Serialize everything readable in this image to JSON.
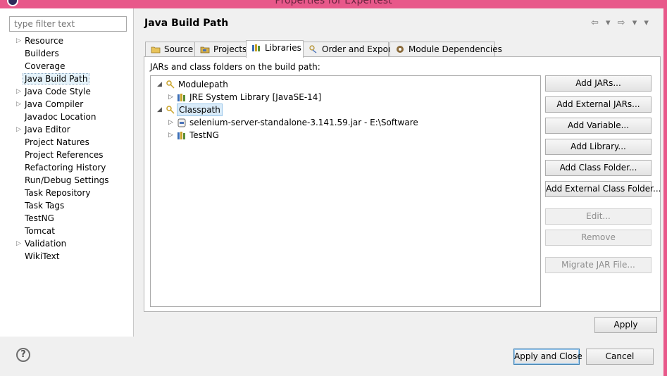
{
  "window": {
    "title": "Properties for Expertest"
  },
  "filter": {
    "placeholder": "type filter text"
  },
  "sidebar": {
    "items": [
      {
        "label": "Resource",
        "expandable": true
      },
      {
        "label": "Builders",
        "expandable": false
      },
      {
        "label": "Coverage",
        "expandable": false
      },
      {
        "label": "Java Build Path",
        "expandable": false,
        "selected": true
      },
      {
        "label": "Java Code Style",
        "expandable": true
      },
      {
        "label": "Java Compiler",
        "expandable": true
      },
      {
        "label": "Javadoc Location",
        "expandable": false
      },
      {
        "label": "Java Editor",
        "expandable": true
      },
      {
        "label": "Project Natures",
        "expandable": false
      },
      {
        "label": "Project References",
        "expandable": false
      },
      {
        "label": "Refactoring History",
        "expandable": false
      },
      {
        "label": "Run/Debug Settings",
        "expandable": false
      },
      {
        "label": "Task Repository",
        "expandable": false
      },
      {
        "label": "Task Tags",
        "expandable": false
      },
      {
        "label": "TestNG",
        "expandable": false
      },
      {
        "label": "Tomcat",
        "expandable": false
      },
      {
        "label": "Validation",
        "expandable": true
      },
      {
        "label": "WikiText",
        "expandable": false
      }
    ]
  },
  "page": {
    "title": "Java Build Path",
    "nav_arrows": "⇦ ▾ ⇨ ▾ ▾"
  },
  "tabs": [
    {
      "label": "Source",
      "icon": "source-folder-icon"
    },
    {
      "label": "Projects",
      "icon": "projects-folder-icon"
    },
    {
      "label": "Libraries",
      "icon": "libraries-icon",
      "active": true
    },
    {
      "label": "Order and Export",
      "icon": "order-export-icon"
    },
    {
      "label": "Module Dependencies",
      "icon": "module-dependencies-icon"
    }
  ],
  "libraries": {
    "heading": "JARs and class folders on the build path:",
    "tree": [
      {
        "label": "Modulepath",
        "expander": "◢",
        "icon": "modulepath-icon"
      },
      {
        "label": "JRE System Library [JavaSE-14]",
        "expander": "▷",
        "icon": "library-icon"
      },
      {
        "label": "Classpath",
        "expander": "◢",
        "icon": "classpath-icon",
        "selected": true
      },
      {
        "label": "selenium-server-standalone-3.141.59.jar - E:\\Software",
        "expander": "▷",
        "icon": "jar-icon"
      },
      {
        "label": "TestNG",
        "expander": "▷",
        "icon": "library-icon"
      }
    ],
    "buttons": [
      {
        "label": "Add JARs...",
        "enabled": true
      },
      {
        "label": "Add External JARs...",
        "enabled": true
      },
      {
        "label": "Add Variable...",
        "enabled": true
      },
      {
        "label": "Add Library...",
        "enabled": true
      },
      {
        "label": "Add Class Folder...",
        "enabled": true
      },
      {
        "label": "Add External Class Folder...",
        "enabled": true
      },
      {
        "label": "Edit...",
        "enabled": false
      },
      {
        "label": "Remove",
        "enabled": false
      },
      {
        "label": "Migrate JAR File...",
        "enabled": false
      }
    ]
  },
  "footer": {
    "apply": "Apply",
    "apply_close": "Apply and Close",
    "cancel": "Cancel",
    "help": "?"
  },
  "colors": {
    "window_frame": "#e8588a",
    "selection": "#d9ebf9",
    "dialog_bg": "#f0f0f0"
  }
}
